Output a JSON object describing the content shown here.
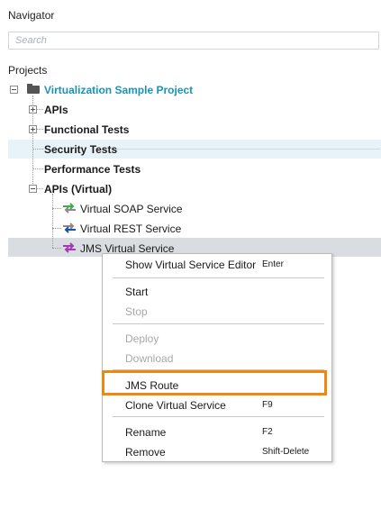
{
  "navigator": {
    "title": "Navigator",
    "search_placeholder": "Search",
    "search_value": ""
  },
  "tree": {
    "root_label": "Projects",
    "project": {
      "name": "Virtualization Sample Project",
      "icon": "folder-icon",
      "expanded": true
    },
    "items": [
      {
        "label": "APIs",
        "expandable": true
      },
      {
        "label": "Functional Tests",
        "expandable": true
      },
      {
        "label": "Security Tests",
        "expandable": false
      },
      {
        "label": "Performance Tests",
        "expandable": false
      },
      {
        "label": "APIs (Virtual)",
        "expandable": true,
        "expanded": true
      }
    ],
    "virtual_services": [
      {
        "label": "Virtual SOAP Service",
        "icon": "soap-service-icon",
        "color": "#3fae49"
      },
      {
        "label": "Virtual REST Service",
        "icon": "rest-service-icon",
        "color": "#1f4fa3"
      },
      {
        "label": "JMS Virtual Service",
        "icon": "jms-service-icon",
        "color": "#a23cb5"
      }
    ]
  },
  "context_menu": {
    "items": [
      {
        "label": "Show Virtual Service Editor",
        "shortcut": "Enter",
        "enabled": true
      },
      {
        "label": "Start",
        "shortcut": "",
        "enabled": true
      },
      {
        "label": "Stop",
        "shortcut": "",
        "enabled": false
      },
      {
        "label": "Deploy",
        "shortcut": "",
        "enabled": false
      },
      {
        "label": "Download",
        "shortcut": "",
        "enabled": false
      },
      {
        "label": "JMS Route",
        "shortcut": "",
        "enabled": true,
        "highlighted": true
      },
      {
        "label": "Clone Virtual Service",
        "shortcut": "F9",
        "enabled": true
      },
      {
        "label": "Rename",
        "shortcut": "F2",
        "enabled": true
      },
      {
        "label": "Remove",
        "shortcut": "Shift-Delete",
        "enabled": true
      }
    ]
  },
  "colors": {
    "project_text": "#1a93b8",
    "highlight_border": "#f0870f",
    "selected_row": "#d9dde1",
    "hover_row": "#e8f2f9"
  }
}
